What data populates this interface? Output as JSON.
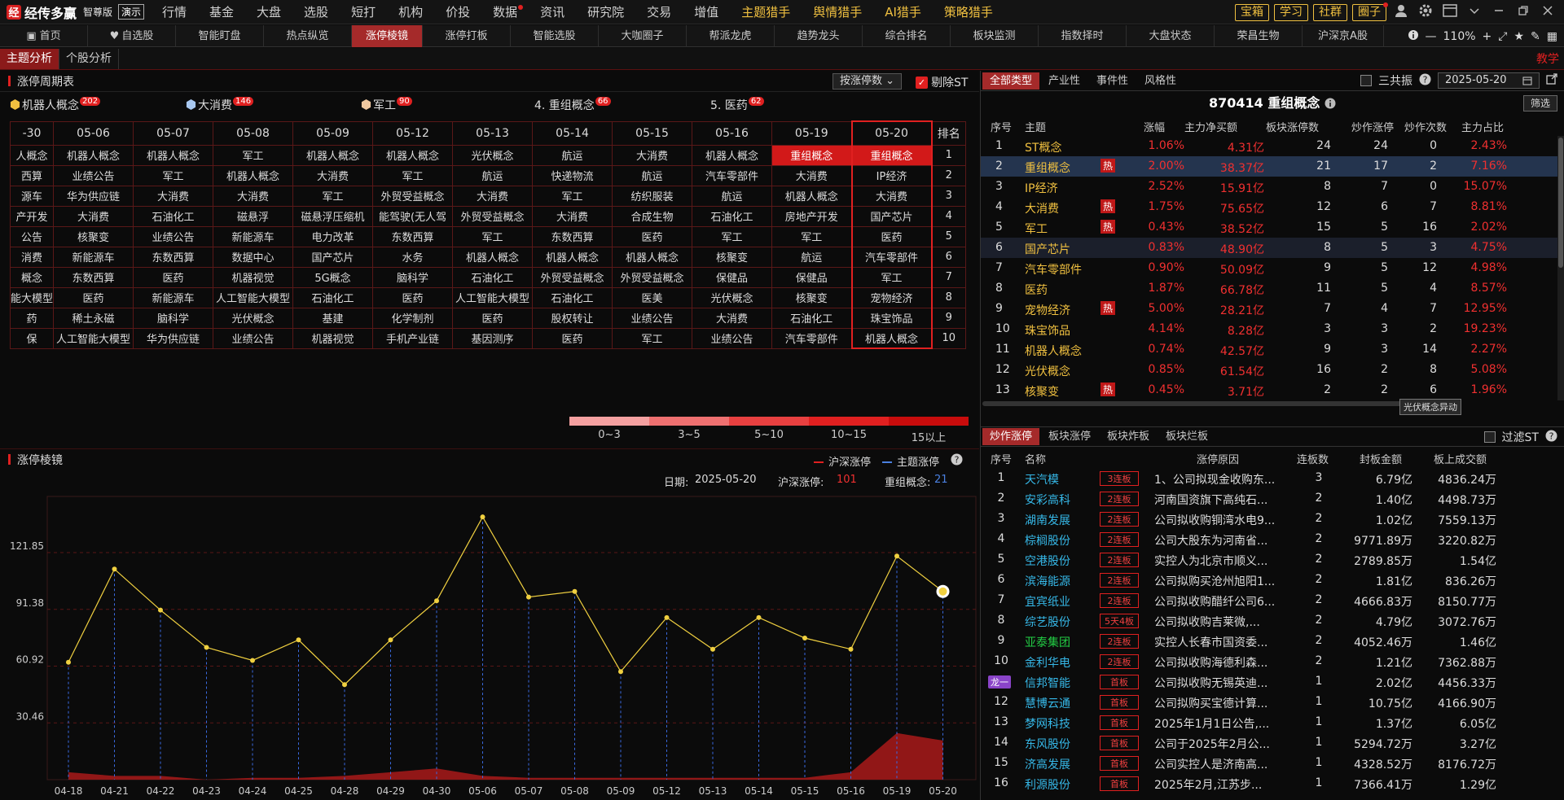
{
  "app": {
    "logo_char": "经",
    "name": "经传多赢",
    "edition": "智尊版",
    "demo": "演示"
  },
  "menu": [
    "行情",
    "基金",
    "大盘",
    "选股",
    "短打",
    "机构",
    "价投",
    "数据",
    "资讯",
    "研究院",
    "交易",
    "增值",
    "主题猎手",
    "舆情猎手",
    "AI猎手",
    "策略猎手"
  ],
  "top_buttons": [
    "宝箱",
    "学习",
    "社群",
    "圈子"
  ],
  "tabs": [
    "首页",
    "自选股",
    "智能盯盘",
    "热点纵览",
    "涨停棱镜",
    "涨停打板",
    "智能选股",
    "大咖圈子",
    "帮派龙虎",
    "趋势龙头",
    "综合排名",
    "板块监测",
    "指数择时",
    "大盘状态",
    "荣昌生物",
    "沪深京A股"
  ],
  "zoom": "110%",
  "subtabs": [
    "主题分析",
    "个股分析"
  ],
  "teach": "教学",
  "cycle": {
    "title": "涨停周期表",
    "sort_label": "按涨停数",
    "exclude_st": "剔除ST",
    "top5": [
      {
        "label": "机器人概念",
        "count": "202"
      },
      {
        "label": "大消费",
        "count": "146"
      },
      {
        "label": "军工",
        "count": "90"
      },
      {
        "label": "4. 重组概念",
        "count": "66"
      },
      {
        "label": "5. 医药",
        "count": "62"
      }
    ],
    "dates": [
      "-30",
      "05-06",
      "05-07",
      "05-08",
      "05-09",
      "05-12",
      "05-13",
      "05-14",
      "05-15",
      "05-16",
      "05-19",
      "05-20"
    ],
    "rank_header": "排名",
    "rows": [
      [
        "人概念",
        "机器人概念",
        "机器人概念",
        "军工",
        "机器人概念",
        "机器人概念",
        "光伏概念",
        "航运",
        "大消费",
        "机器人概念",
        "重组概念",
        "重组概念",
        "1"
      ],
      [
        "西算",
        "业绩公告",
        "军工",
        "机器人概念",
        "大消费",
        "军工",
        "航运",
        "快递物流",
        "航运",
        "汽车零部件",
        "大消费",
        "IP经济",
        "2"
      ],
      [
        "源车",
        "华为供应链",
        "大消费",
        "大消费",
        "军工",
        "外贸受益概念",
        "大消费",
        "军工",
        "纺织服装",
        "航运",
        "机器人概念",
        "大消费",
        "3"
      ],
      [
        "产开发",
        "大消费",
        "石油化工",
        "磁悬浮",
        "磁悬浮压缩机",
        "能驾驶(无人驾",
        "外贸受益概念",
        "大消费",
        "合成生物",
        "石油化工",
        "房地产开发",
        "国产芯片",
        "4"
      ],
      [
        "公告",
        "核聚变",
        "业绩公告",
        "新能源车",
        "电力改革",
        "东数西算",
        "军工",
        "东数西算",
        "医药",
        "军工",
        "军工",
        "医药",
        "5"
      ],
      [
        "消费",
        "新能源车",
        "东数西算",
        "数据中心",
        "国产芯片",
        "水务",
        "机器人概念",
        "机器人概念",
        "机器人概念",
        "核聚变",
        "航运",
        "汽车零部件",
        "6"
      ],
      [
        "概念",
        "东数西算",
        "医药",
        "机器视觉",
        "5G概念",
        "脑科学",
        "石油化工",
        "外贸受益概念",
        "外贸受益概念",
        "保健品",
        "保健品",
        "军工",
        "7"
      ],
      [
        "能大模型",
        "医药",
        "新能源车",
        "人工智能大模型",
        "石油化工",
        "医药",
        "人工智能大模型",
        "石油化工",
        "医美",
        "光伏概念",
        "核聚变",
        "宠物经济",
        "8"
      ],
      [
        "药",
        "稀土永磁",
        "脑科学",
        "光伏概念",
        "基建",
        "化学制剂",
        "医药",
        "股权转让",
        "业绩公告",
        "大消费",
        "石油化工",
        "珠宝饰品",
        "9"
      ],
      [
        "保",
        "人工智能大模型",
        "华为供应链",
        "业绩公告",
        "机器视觉",
        "手机产业链",
        "基因测序",
        "医药",
        "军工",
        "业绩公告",
        "汽车零部件",
        "机器人概念",
        "10"
      ]
    ],
    "legend": [
      {
        "label": "0~3",
        "color": "#f4a0a0"
      },
      {
        "label": "3~5",
        "color": "#ee7070"
      },
      {
        "label": "5~10",
        "color": "#e84040"
      },
      {
        "label": "10~15",
        "color": "#e02020"
      },
      {
        "label": "15以上",
        "color": "#c80c0c"
      }
    ]
  },
  "prism": {
    "title": "涨停棱镜",
    "legend_sh": "沪深涨停",
    "legend_theme": "主题涨停",
    "date_label": "日期:",
    "date": "2025-05-20",
    "sh_label": "沪深涨停:",
    "sh_value": "101",
    "theme_label": "重组概念:",
    "theme_value": "21"
  },
  "chart_data": {
    "type": "line",
    "title": "",
    "xlabel": "",
    "ylabel": "",
    "x": [
      "04-18",
      "04-21",
      "04-22",
      "04-23",
      "04-24",
      "04-25",
      "04-28",
      "04-29",
      "04-30",
      "05-06",
      "05-07",
      "05-08",
      "05-09",
      "05-12",
      "05-13",
      "05-14",
      "05-15",
      "05-16",
      "05-19",
      "05-20"
    ],
    "yticks": [
      30.46,
      60.92,
      91.38,
      121.85
    ],
    "ylim": [
      0,
      152
    ],
    "series": [
      {
        "name": "沪深涨停",
        "color": "#f0d040",
        "values": [
          63,
          113,
          91,
          71,
          64,
          75,
          51,
          75,
          96,
          141,
          98,
          101,
          58,
          87,
          70,
          87,
          76,
          70,
          120,
          101
        ]
      },
      {
        "name": "主题涨停",
        "color": "#a01818",
        "values": [
          4,
          2,
          2,
          0,
          1,
          1,
          2,
          4,
          6,
          2,
          1,
          1,
          1,
          1,
          1,
          1,
          1,
          4,
          25,
          21
        ]
      }
    ]
  },
  "right_top": {
    "tabs": [
      "全部类型",
      "产业性",
      "事件性",
      "风格性"
    ],
    "sanjuzhen": "三共振",
    "date": "2025-05-20",
    "title": "870414 重组概念",
    "filter": "筛选",
    "headers": [
      "序号",
      "主题",
      "涨幅",
      "主力净买额",
      "板块涨停数",
      "炒作涨停",
      "炒作次数",
      "主力占比"
    ],
    "rows": [
      {
        "no": "1",
        "name": "ST概念",
        "hot": "",
        "pct": "1.06%",
        "net": "4.31亿",
        "limit": "24",
        "hype": "24",
        "times": "0",
        "ratio": "2.43%"
      },
      {
        "no": "2",
        "name": "重组概念",
        "hot": "热",
        "pct": "2.00%",
        "net": "38.37亿",
        "limit": "21",
        "hype": "17",
        "times": "2",
        "ratio": "7.16%"
      },
      {
        "no": "3",
        "name": "IP经济",
        "hot": "",
        "pct": "2.52%",
        "net": "15.91亿",
        "limit": "8",
        "hype": "7",
        "times": "0",
        "ratio": "15.07%"
      },
      {
        "no": "4",
        "name": "大消费",
        "hot": "热",
        "pct": "1.75%",
        "net": "75.65亿",
        "limit": "12",
        "hype": "6",
        "times": "7",
        "ratio": "8.81%"
      },
      {
        "no": "5",
        "name": "军工",
        "hot": "热",
        "pct": "0.43%",
        "net": "38.52亿",
        "limit": "15",
        "hype": "5",
        "times": "16",
        "ratio": "2.02%"
      },
      {
        "no": "6",
        "name": "国产芯片",
        "hot": "",
        "pct": "0.83%",
        "net": "48.90亿",
        "limit": "8",
        "hype": "5",
        "times": "3",
        "ratio": "4.75%"
      },
      {
        "no": "7",
        "name": "汽车零部件",
        "hot": "",
        "pct": "0.90%",
        "net": "50.09亿",
        "limit": "9",
        "hype": "5",
        "times": "12",
        "ratio": "4.98%"
      },
      {
        "no": "8",
        "name": "医药",
        "hot": "",
        "pct": "1.87%",
        "net": "66.78亿",
        "limit": "11",
        "hype": "5",
        "times": "4",
        "ratio": "8.57%"
      },
      {
        "no": "9",
        "name": "宠物经济",
        "hot": "热",
        "pct": "5.00%",
        "net": "28.21亿",
        "limit": "7",
        "hype": "4",
        "times": "7",
        "ratio": "12.95%"
      },
      {
        "no": "10",
        "name": "珠宝饰品",
        "hot": "",
        "pct": "4.14%",
        "net": "8.28亿",
        "limit": "3",
        "hype": "3",
        "times": "2",
        "ratio": "19.23%"
      },
      {
        "no": "11",
        "name": "机器人概念",
        "hot": "",
        "pct": "0.74%",
        "net": "42.57亿",
        "limit": "9",
        "hype": "3",
        "times": "14",
        "ratio": "2.27%"
      },
      {
        "no": "12",
        "name": "光伏概念",
        "hot": "",
        "pct": "0.85%",
        "net": "61.54亿",
        "limit": "16",
        "hype": "2",
        "times": "8",
        "ratio": "5.08%"
      },
      {
        "no": "13",
        "name": "核聚变",
        "hot": "热",
        "pct": "0.45%",
        "net": "3.71亿",
        "limit": "2",
        "hype": "2",
        "times": "6",
        "ratio": "1.96%"
      }
    ],
    "tooltip": "光伏概念异动"
  },
  "right_bottom": {
    "tabs": [
      "炒作涨停",
      "板块涨停",
      "板块炸板",
      "板块烂板"
    ],
    "filter_st": "过滤ST",
    "headers": [
      "序号",
      "名称",
      "涨停原因",
      "连板数",
      "封板金额",
      "板上成交额"
    ],
    "rows": [
      {
        "no": "1",
        "name": "天汽模",
        "tag": "3连板",
        "reason": "1、公司拟现金收购东...",
        "days": "3",
        "seal": "6.79亿",
        "turn": "4836.24万",
        "color": "cy"
      },
      {
        "no": "2",
        "name": "安彩高科",
        "tag": "2连板",
        "reason": "河南国资旗下高纯石...",
        "days": "2",
        "seal": "1.40亿",
        "turn": "4498.73万",
        "color": "cy"
      },
      {
        "no": "3",
        "name": "湖南发展",
        "tag": "2连板",
        "reason": "公司拟收购铜湾水电9...",
        "days": "2",
        "seal": "1.02亿",
        "turn": "7559.13万",
        "color": "cy"
      },
      {
        "no": "4",
        "name": "棕榈股份",
        "tag": "2连板",
        "reason": "公司大股东为河南省...",
        "days": "2",
        "seal": "9771.89万",
        "turn": "3220.82万",
        "color": "cy"
      },
      {
        "no": "5",
        "name": "空港股份",
        "tag": "2连板",
        "reason": "实控人为北京市顺义...",
        "days": "2",
        "seal": "2789.85万",
        "turn": "1.54亿",
        "color": "cy"
      },
      {
        "no": "6",
        "name": "滨海能源",
        "tag": "2连板",
        "reason": "公司拟购买沧州旭阳1...",
        "days": "2",
        "seal": "1.81亿",
        "turn": "836.26万",
        "color": "cy"
      },
      {
        "no": "7",
        "name": "宜宾纸业",
        "tag": "2连板",
        "reason": "公司拟收购醋纤公司6...",
        "days": "2",
        "seal": "4666.83万",
        "turn": "8150.77万",
        "color": "cy"
      },
      {
        "no": "8",
        "name": "综艺股份",
        "tag": "5天4板",
        "reason": "公司拟收购吉莱微,...",
        "days": "2",
        "seal": "4.79亿",
        "turn": "3072.76万",
        "color": "cy"
      },
      {
        "no": "9",
        "name": "亚泰集团",
        "tag": "2连板",
        "reason": "实控人长春市国资委...",
        "days": "2",
        "seal": "4052.46万",
        "turn": "1.46亿",
        "color": "g"
      },
      {
        "no": "10",
        "name": "金利华电",
        "tag": "2连板",
        "reason": "公司拟收购海德利森...",
        "days": "2",
        "seal": "1.21亿",
        "turn": "7362.88万",
        "color": "cy"
      },
      {
        "no": "龙一",
        "name": "信邦智能",
        "tag": "首板",
        "reason": "公司拟收购无锡英迪...",
        "days": "1",
        "seal": "2.02亿",
        "turn": "4456.33万",
        "color": "cy"
      },
      {
        "no": "12",
        "name": "慧博云通",
        "tag": "首板",
        "reason": "公司拟购买宝德计算...",
        "days": "1",
        "seal": "10.75亿",
        "turn": "4166.90万",
        "color": "cy"
      },
      {
        "no": "13",
        "name": "梦网科技",
        "tag": "首板",
        "reason": "2025年1月1日公告,...",
        "days": "1",
        "seal": "1.37亿",
        "turn": "6.05亿",
        "color": "cy"
      },
      {
        "no": "14",
        "name": "东风股份",
        "tag": "首板",
        "reason": "公司于2025年2月公...",
        "days": "1",
        "seal": "5294.72万",
        "turn": "3.27亿",
        "color": "cy"
      },
      {
        "no": "15",
        "name": "济高发展",
        "tag": "首板",
        "reason": "公司实控人是济南高...",
        "days": "1",
        "seal": "4328.52万",
        "turn": "8176.72万",
        "color": "cy"
      },
      {
        "no": "16",
        "name": "利源股份",
        "tag": "首板",
        "reason": "2025年2月,江苏步...",
        "days": "1",
        "seal": "7366.41万",
        "turn": "1.29亿",
        "color": "cy"
      }
    ]
  }
}
